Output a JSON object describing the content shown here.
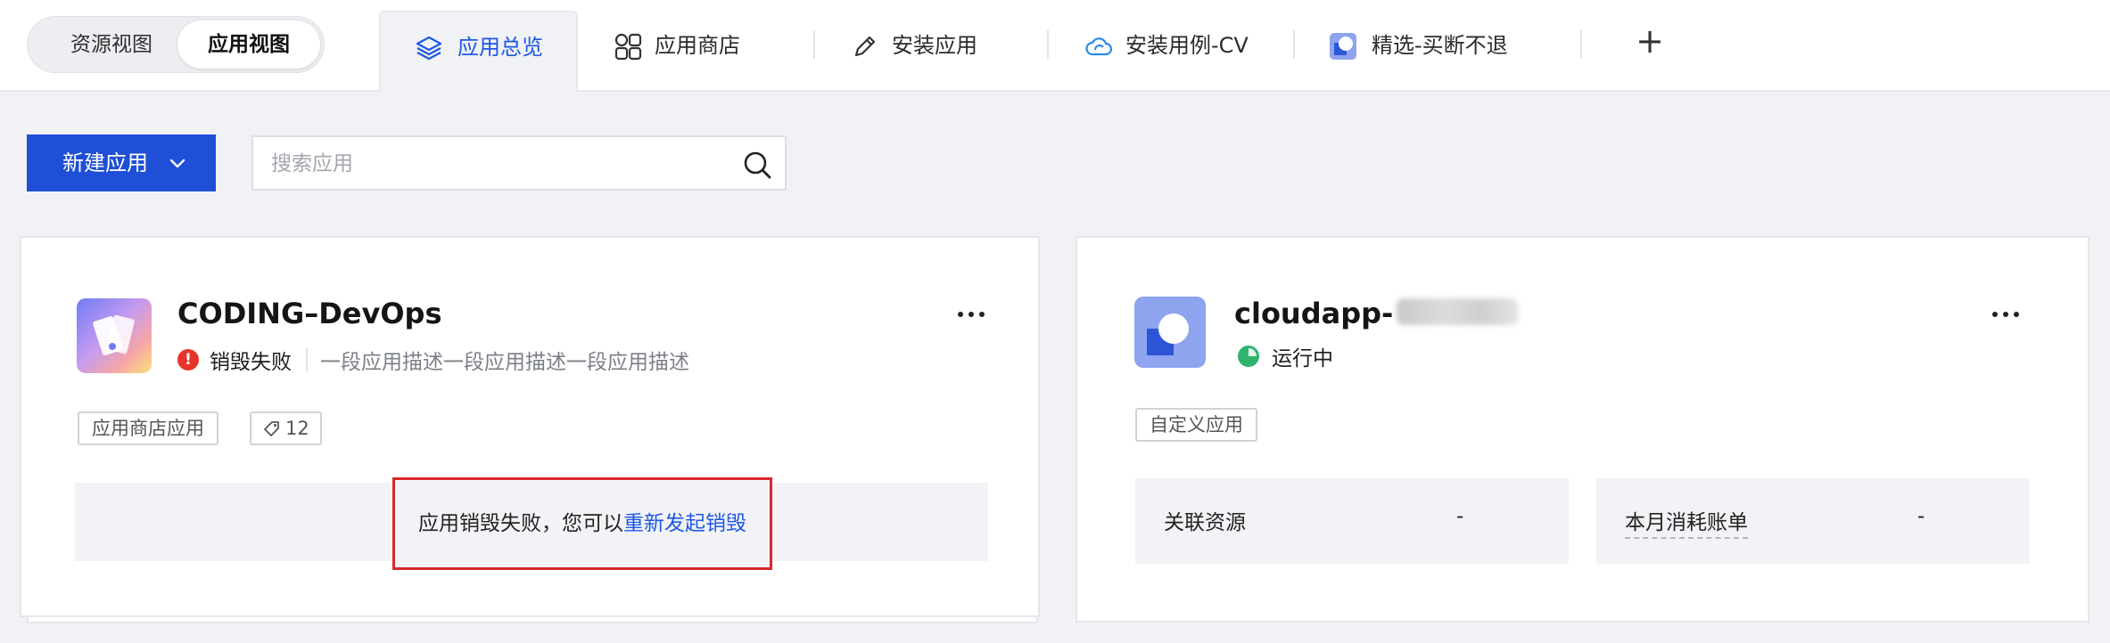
{
  "view_toggle": {
    "options": [
      {
        "label": "资源视图",
        "active": false
      },
      {
        "label": "应用视图",
        "active": true
      }
    ]
  },
  "tabs": [
    {
      "label": "应用总览",
      "icon": "layers-icon",
      "active": true
    },
    {
      "label": "应用商店",
      "icon": "grid-icon",
      "active": false
    },
    {
      "label": "安装应用",
      "icon": "pencil-icon",
      "active": false
    },
    {
      "label": "安装用例-CV",
      "icon": "cloud-icon",
      "active": false
    },
    {
      "label": "精选-买断不退",
      "icon": "app-square-icon",
      "active": false
    }
  ],
  "add_tab_label": "+",
  "toolbar": {
    "new_app_label": "新建应用",
    "search_placeholder": "搜索应用"
  },
  "cards": [
    {
      "title": "CODING–DevOps",
      "status": "销毁失败",
      "status_color": "#e5352b",
      "description": "一段应用描述一段应用描述一段应用描述",
      "tags": [
        "应用商店应用"
      ],
      "tag_count": "12",
      "notice_text": "应用销毁失败，您可以",
      "notice_link": "重新发起销毁"
    },
    {
      "title": "cloudapp-",
      "status": "运行中",
      "status_color": "#2fb46f",
      "tags": [
        "自定义应用"
      ],
      "stats": [
        {
          "label": "关联资源",
          "value": "-"
        },
        {
          "label": "本月消耗账单",
          "value": "-"
        }
      ]
    }
  ],
  "colors": {
    "accent": "#1d58e6",
    "primary_button": "#1e4fd6",
    "highlight_border": "#d9272c"
  }
}
